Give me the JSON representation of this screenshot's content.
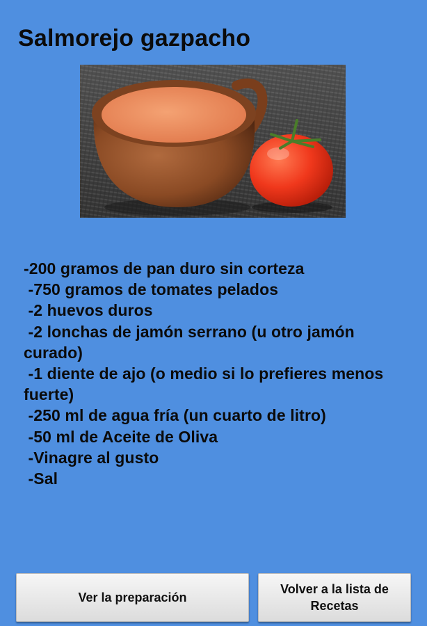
{
  "recipe": {
    "title": "Salmorejo gazpacho",
    "image_description": "photo-bowl-of-salmorejo-with-tomato",
    "ingredients": [
      "-200 gramos de pan duro sin corteza",
      " -750 gramos de tomates pelados",
      " -2 huevos duros",
      " -2 lonchas de jamón serrano (u otro jamón curado)",
      " -1 diente de ajo (o medio si lo prefieres menos fuerte)",
      " -250 ml de agua fría (un cuarto de litro)",
      " -50 ml de Aceite de Oliva",
      " -Vinagre al gusto",
      " -Sal"
    ]
  },
  "buttons": {
    "preparation": "Ver la preparación",
    "back": "Volver a la lista de Recetas"
  },
  "colors": {
    "background": "#4f8fe0",
    "button": "#e8e8e8",
    "text": "#0b0b0b"
  }
}
